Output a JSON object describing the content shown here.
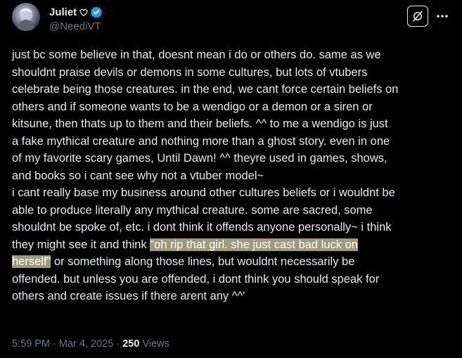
{
  "author": {
    "display_name": "Juliet",
    "name_emoji": "heart-outline",
    "verified": true,
    "handle": "@NeediVT"
  },
  "colors": {
    "background": "#000000",
    "text": "#e7e9ea",
    "secondary_text": "#71767b",
    "verified_badge": "#1d9bf0",
    "highlight": "#ded6a6"
  },
  "icons": {
    "grok": "grok-icon",
    "more": "more-dots-icon",
    "verified": "verified-badge-icon"
  },
  "tweet": {
    "lines": [
      "just bc some believe in that, doesnt mean i do or others do. same as we",
      "shouldnt praise devils or demons in some cultures, but lots of vtubers",
      "celebrate being those creatures. in the end, we cant force certain beliefs on",
      "others and if someone wants to be a wendigo or a demon or a siren or",
      "kitsune, then thats up to them and their beliefs. ^^ to me a wendigo is just",
      "a fake mythical creature and nothing more than a ghost story. even in one",
      "of my favorite scary games, Until Dawn! ^^ theyre used in games, shows,",
      "and books so i cant see why not a vtuber model~",
      "i cant really base my business around other cultures beliefs or i wouldnt be",
      "able to produce literally any mythical creature. some are sacred, some",
      "shouldnt be spoke of, etc. i dont think it offends anyone personally~ i think"
    ],
    "line12_before": "they might see it and think ",
    "line12_highlight": "\"oh rip that girl. she just cast bad luck on",
    "line13_highlight": "herself\"",
    "line13_after": " or something along those lines, but wouldnt necessarily be",
    "lines_end": [
      "offended. but unless you are offended, i dont think you should speak for",
      "others and create issues if there arent any ^^'"
    ]
  },
  "meta": {
    "time": "5:59 PM",
    "separator": "·",
    "date": "Mar 4, 2025",
    "views_count": "250",
    "views_label": "Views"
  }
}
